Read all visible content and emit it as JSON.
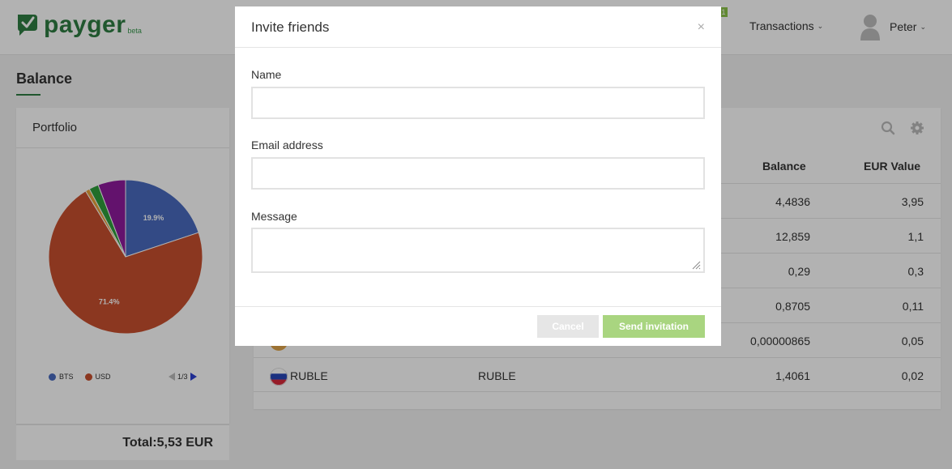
{
  "app": {
    "logo_text": "payger",
    "logo_badge": "beta"
  },
  "nav": {
    "notification_count": "1",
    "transactions_label": "Transactions",
    "user_name": "Peter"
  },
  "page": {
    "title": "Balance"
  },
  "portfolio": {
    "title": "Portfolio",
    "total": "Total:5,53 EUR",
    "legend": [
      {
        "name": "BTS",
        "color": "#4a6bbf"
      },
      {
        "name": "USD",
        "color": "#c8502e"
      }
    ],
    "pager": "1/3"
  },
  "chart_data": {
    "type": "pie",
    "slices": [
      {
        "name": "BTS",
        "percent": 19.9,
        "color": "#4a6bbf",
        "label": "19.9%"
      },
      {
        "name": "USD",
        "percent": 71.4,
        "color": "#c8502e",
        "label": "71.4%"
      },
      {
        "name": "",
        "percent": 0.9,
        "color": "#e8a23a",
        "label": ""
      },
      {
        "name": "",
        "percent": 2.0,
        "color": "#2f9e3c",
        "label": ""
      },
      {
        "name": "",
        "percent": 5.8,
        "color": "#8e1b9c",
        "label": ""
      }
    ]
  },
  "balance_table": {
    "columns": {
      "balance": "Balance",
      "eur_value": "EUR Value"
    },
    "rows": [
      {
        "name": "",
        "currency": "",
        "balance": "4,4836",
        "eur_value": "3,95"
      },
      {
        "name": "",
        "currency": "",
        "balance": "12,859",
        "eur_value": "1,1"
      },
      {
        "name": "",
        "currency": "",
        "balance": "0,29",
        "eur_value": "0,3"
      },
      {
        "name": "",
        "currency": "",
        "balance": "0,8705",
        "eur_value": "0,11"
      },
      {
        "name": "",
        "currency": "",
        "balance": "0,00000865",
        "eur_value": "0,05"
      },
      {
        "name": "RUBLE",
        "currency": "RUBLE",
        "balance": "1,4061",
        "eur_value": "0,02"
      }
    ]
  },
  "modal": {
    "title": "Invite friends",
    "close_glyph": "×",
    "name_label": "Name",
    "name_value": "",
    "email_label": "Email address",
    "email_value": "",
    "message_label": "Message",
    "message_value": "",
    "cancel_label": "Cancel",
    "send_label": "Send invitation"
  }
}
